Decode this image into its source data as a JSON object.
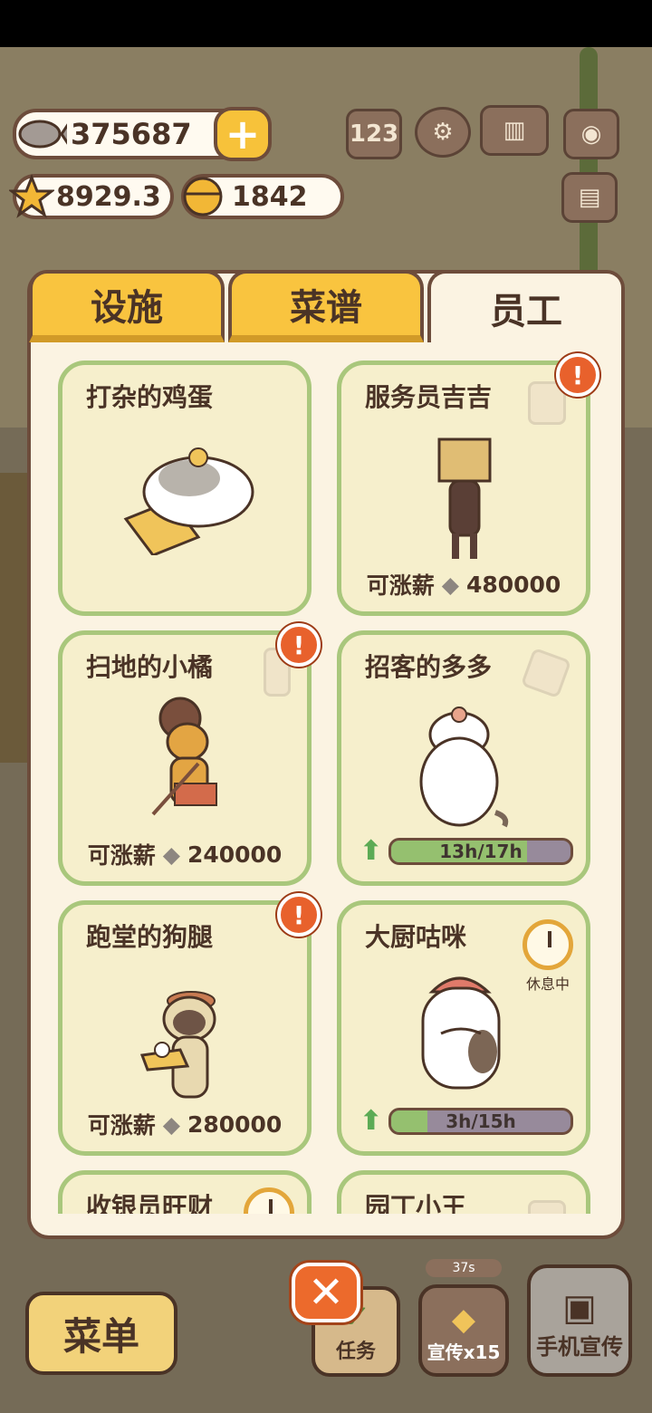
{
  "currencies": {
    "fish": "375687",
    "stars": "8929.3",
    "bells": "1842",
    "add_label": "+"
  },
  "header_icons": [
    "ranking-icon",
    "settings-gear-icon",
    "recipe-book-icon",
    "camera-icon",
    "id-card-icon"
  ],
  "tabs": [
    {
      "label": "设施",
      "active": false
    },
    {
      "label": "菜谱",
      "active": false
    },
    {
      "label": "员工",
      "active": true
    }
  ],
  "staff": [
    {
      "name": "打杂的鸡蛋"
    },
    {
      "name": "服务员吉吉",
      "salary_label": "可涨薪",
      "salary": "480000",
      "alert": "!"
    },
    {
      "name": "扫地的小橘",
      "salary_label": "可涨薪",
      "salary": "240000",
      "alert": "!"
    },
    {
      "name": "招客的多多",
      "progress": "13h/17h",
      "progress_value": 0.76
    },
    {
      "name": "跑堂的狗腿",
      "salary_label": "可涨薪",
      "salary": "280000",
      "alert": "!"
    },
    {
      "name": "大厨咕咪",
      "status": "休息中",
      "progress": "3h/15h",
      "progress_value": 0.2
    },
    {
      "name": "收银员旺财"
    },
    {
      "name": "园丁小王"
    }
  ],
  "bottom_bar": {
    "menu_label": "菜单",
    "task_label": "任务",
    "promo_label": "宣传x15",
    "promo_countdown": "37s",
    "phone_promo_label": "手机宣传",
    "close_label": "✕"
  }
}
